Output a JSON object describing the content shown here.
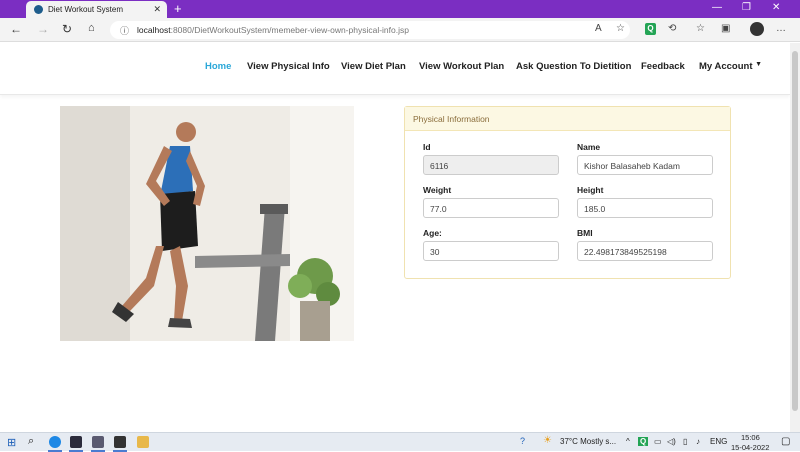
{
  "browser": {
    "tab_title": "Diet Workout System",
    "tab_close": "✕",
    "new_tab": "+",
    "url_host": "localhost",
    "url_path": ":8080/DietWorkoutSystem/memeber-view-own-physical-info.jsp"
  },
  "navbar": {
    "items": [
      {
        "label": "Home"
      },
      {
        "label": "View Physical Info"
      },
      {
        "label": "View Diet Plan"
      },
      {
        "label": "View Workout Plan"
      },
      {
        "label": "Ask Question To Dietition"
      },
      {
        "label": "Feedback"
      },
      {
        "label": "My Account"
      }
    ]
  },
  "panel": {
    "title": "Physical Information",
    "fields": {
      "id": {
        "label": "Id",
        "value": "6116"
      },
      "name": {
        "label": "Name",
        "value": "Kishor Balasaheb Kadam"
      },
      "weight": {
        "label": "Weight",
        "value": "77.0"
      },
      "height": {
        "label": "Height",
        "value": "185.0"
      },
      "age": {
        "label": "Age:",
        "value": "30"
      },
      "bmi": {
        "label": "BMI",
        "value": "22.498173849525198"
      }
    }
  },
  "taskbar": {
    "weather": "37°C  Mostly s...",
    "language": "ENG",
    "time": "15:06",
    "date": "15-04-2022"
  },
  "colors": {
    "titlebar": "#7b2ec2",
    "nav_active": "#2aa7d8",
    "panel_header_bg": "#fcf8e3",
    "panel_header_text": "#8a6d3b"
  }
}
